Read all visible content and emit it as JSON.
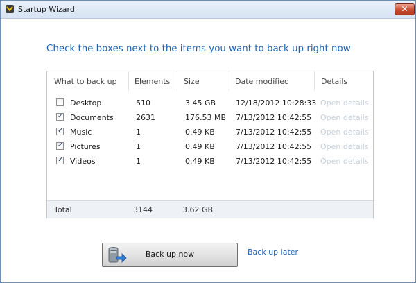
{
  "window": {
    "title": "Startup Wizard",
    "close_label": "✕",
    "app_icon": "wizard-app-icon"
  },
  "heading": "Check the boxes next to the items you want to back up right now",
  "table": {
    "columns": [
      "What to back up",
      "Elements",
      "Size",
      "Date modified",
      "Details"
    ],
    "rows": [
      {
        "checked": false,
        "name": "Desktop",
        "elements": "510",
        "size": "3.45 GB",
        "date": "12/18/2012 10:28:33",
        "details": "Open details"
      },
      {
        "checked": true,
        "name": "Documents",
        "elements": "2631",
        "size": "176.53 MB",
        "date": "7/13/2012 10:42:55",
        "details": "Open details"
      },
      {
        "checked": true,
        "name": "Music",
        "elements": "1",
        "size": "0.49 KB",
        "date": "7/13/2012 10:42:55",
        "details": "Open details"
      },
      {
        "checked": true,
        "name": "Pictures",
        "elements": "1",
        "size": "0.49 KB",
        "date": "7/13/2012 10:42:55",
        "details": "Open details"
      },
      {
        "checked": true,
        "name": "Videos",
        "elements": "1",
        "size": "0.49 KB",
        "date": "7/13/2012 10:42:55",
        "details": "Open details"
      }
    ],
    "total": {
      "label": "Total",
      "elements": "3144",
      "size": "3.62 GB"
    }
  },
  "actions": {
    "backup_now": "Back up now",
    "backup_icon": "backup-drive-icon",
    "backup_later": "Back up later"
  },
  "colors": {
    "heading": "#1f63b0",
    "link": "#1f5fb3",
    "disabled_link": "#c6cfdc"
  }
}
